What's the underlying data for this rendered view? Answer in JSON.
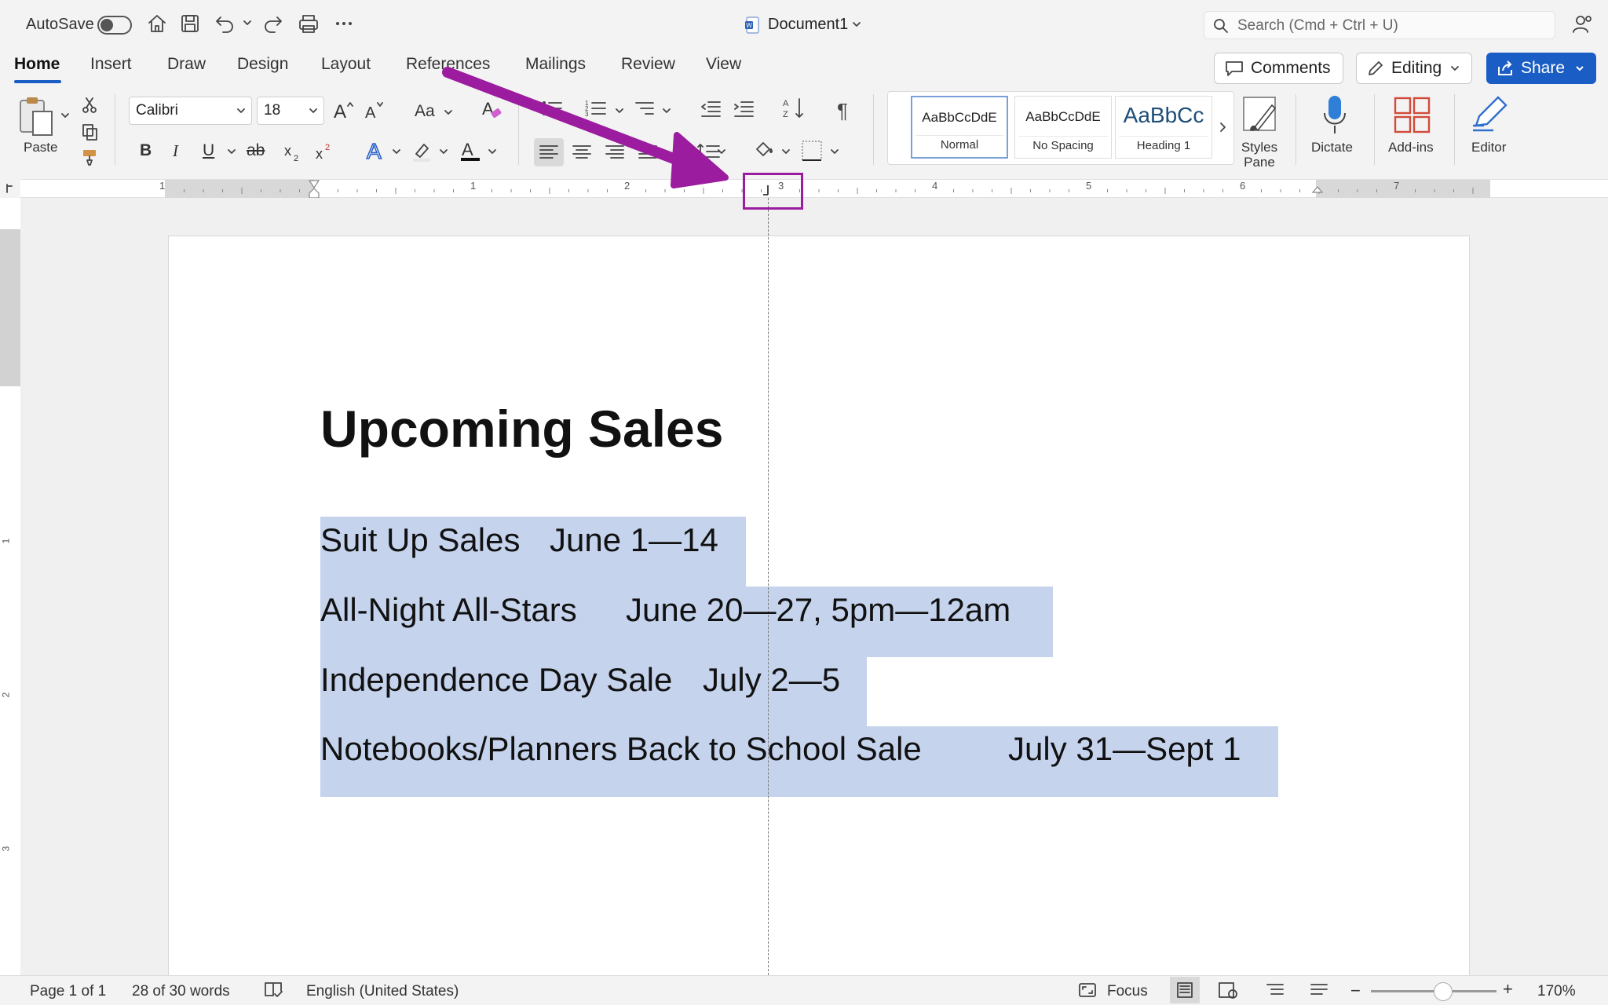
{
  "titlebar": {
    "autosave_label": "AutoSave",
    "doc_title": "Document1",
    "search_placeholder": "Search (Cmd + Ctrl + U)"
  },
  "tabs": [
    "Home",
    "Insert",
    "Draw",
    "Design",
    "Layout",
    "References",
    "Mailings",
    "Review",
    "View"
  ],
  "actions": {
    "comments": "Comments",
    "editing": "Editing",
    "share": "Share"
  },
  "ribbon": {
    "paste_label": "Paste",
    "font_name": "Calibri",
    "font_size": "18",
    "change_case": "Aa",
    "bold": "B",
    "italic": "I",
    "underline": "U",
    "strike": "ab",
    "styles": [
      {
        "preview": "AaBbCcDdE",
        "name": "Normal"
      },
      {
        "preview": "AaBbCcDdE",
        "name": "No Spacing"
      },
      {
        "preview": "AaBbCc",
        "name": "Heading 1"
      }
    ],
    "styles_pane": "Styles\nPane",
    "dictate": "Dictate",
    "addins": "Add-ins",
    "editor": "Editor"
  },
  "ruler": {
    "numbers": [
      "1",
      "1",
      "2",
      "3",
      "4",
      "5",
      "6",
      "7"
    ]
  },
  "document": {
    "title": "Upcoming Sales",
    "lines": [
      {
        "name": "Suit Up Sales",
        "date": "June 1—14"
      },
      {
        "name": "All-Night All-Stars",
        "date": "June 20—27, 5pm—12am"
      },
      {
        "name": "Independence Day Sale",
        "date": "July 2—5"
      },
      {
        "name": "Notebooks/Planners Back to School Sale",
        "date": "July 31—Sept 1"
      }
    ]
  },
  "vruler": [
    "1",
    "2",
    "3"
  ],
  "statusbar": {
    "page": "Page 1 of 1",
    "words": "28 of 30 words",
    "language": "English (United States)",
    "focus": "Focus",
    "zoom": "170%"
  },
  "colors": {
    "accent": "#1a5dc4",
    "selection": "#c5d3ed",
    "annotation": "#9b1c9e"
  }
}
